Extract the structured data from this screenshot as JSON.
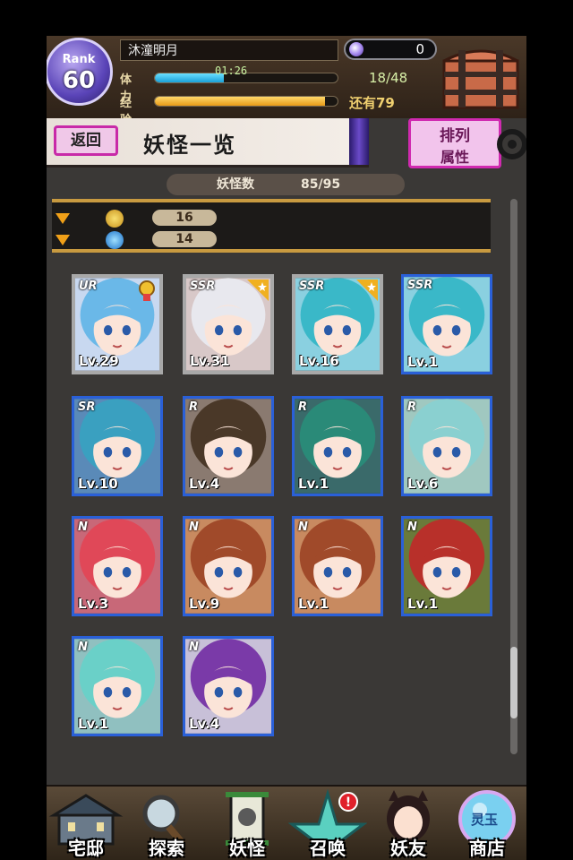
{
  "header": {
    "rank_label": "Rank",
    "rank_value": "60",
    "player_name": "沐潼明月",
    "gems": "0",
    "stamina": {
      "label": "体力",
      "timer": "01:26",
      "value": "18/48",
      "fraction": 0.375
    },
    "exp": {
      "label": "经验",
      "value": "还有79",
      "fraction": 0.93
    }
  },
  "titlebar": {
    "back": "返回",
    "title": "妖怪一览",
    "sort_line1": "排列",
    "sort_line2": "属性"
  },
  "count": {
    "label": "妖怪数",
    "value": "85/95"
  },
  "filters": [
    {
      "icon": "coin-icon",
      "value": "16"
    },
    {
      "icon": "soul-icon",
      "value": "14"
    }
  ],
  "cards": [
    {
      "rarity": "UR",
      "level": "Lv.29",
      "selected": true,
      "badge": "medal-icon",
      "hair": "#6ab8e8",
      "bg": "#c8d8f0"
    },
    {
      "rarity": "SSR",
      "level": "Lv.31",
      "selected": true,
      "badge": "star-icon",
      "hair": "#e8e8ee",
      "bg": "#d8c8c8"
    },
    {
      "rarity": "SSR",
      "level": "Lv.16",
      "selected": true,
      "badge": "star-icon",
      "hair": "#3ab8c8",
      "bg": "#8ad0e0"
    },
    {
      "rarity": "SSR",
      "level": "Lv.1",
      "selected": false,
      "badge": "",
      "hair": "#3ab8c8",
      "bg": "#8ad0e0"
    },
    {
      "rarity": "SR",
      "level": "Lv.10",
      "selected": false,
      "badge": "",
      "hair": "#3aa0c0",
      "bg": "#5a8ab8"
    },
    {
      "rarity": "R",
      "level": "Lv.4",
      "selected": false,
      "badge": "",
      "hair": "#4a3828",
      "bg": "#8a7a70"
    },
    {
      "rarity": "R",
      "level": "Lv.1",
      "selected": false,
      "badge": "",
      "hair": "#2a8a78",
      "bg": "#3a6a6a"
    },
    {
      "rarity": "R",
      "level": "Lv.6",
      "selected": false,
      "badge": "",
      "hair": "#8ad0d0",
      "bg": "#a0c8c0"
    },
    {
      "rarity": "N",
      "level": "Lv.3",
      "selected": false,
      "badge": "",
      "hair": "#e04858",
      "bg": "#c86878"
    },
    {
      "rarity": "N",
      "level": "Lv.9",
      "selected": false,
      "badge": "",
      "hair": "#a04a2a",
      "bg": "#c88a60"
    },
    {
      "rarity": "N",
      "level": "Lv.1",
      "selected": false,
      "badge": "",
      "hair": "#a04a2a",
      "bg": "#c88a60"
    },
    {
      "rarity": "N",
      "level": "Lv.1",
      "selected": false,
      "badge": "",
      "hair": "#b8302a",
      "bg": "#6a7a3a"
    },
    {
      "rarity": "N",
      "level": "Lv.1",
      "selected": false,
      "badge": "",
      "hair": "#6ad0c8",
      "bg": "#90c0c0"
    },
    {
      "rarity": "N",
      "level": "Lv.4",
      "selected": false,
      "badge": "",
      "hair": "#7a3aa8",
      "bg": "#c8c0d8"
    }
  ],
  "nav": [
    {
      "label": "宅邸",
      "icon": "house-icon"
    },
    {
      "label": "探索",
      "icon": "magnifier-icon"
    },
    {
      "label": "妖怪",
      "icon": "scroll-icon"
    },
    {
      "label": "召唤",
      "icon": "pentagram-icon",
      "alert": "!"
    },
    {
      "label": "妖友",
      "icon": "friend-icon"
    },
    {
      "label": "商店",
      "icon": "orb-icon",
      "badge_text": "灵玉"
    }
  ],
  "colors": {
    "accent_pink": "#d02ab0",
    "card_border": "#2a60d8",
    "gold": "#c89a40"
  }
}
